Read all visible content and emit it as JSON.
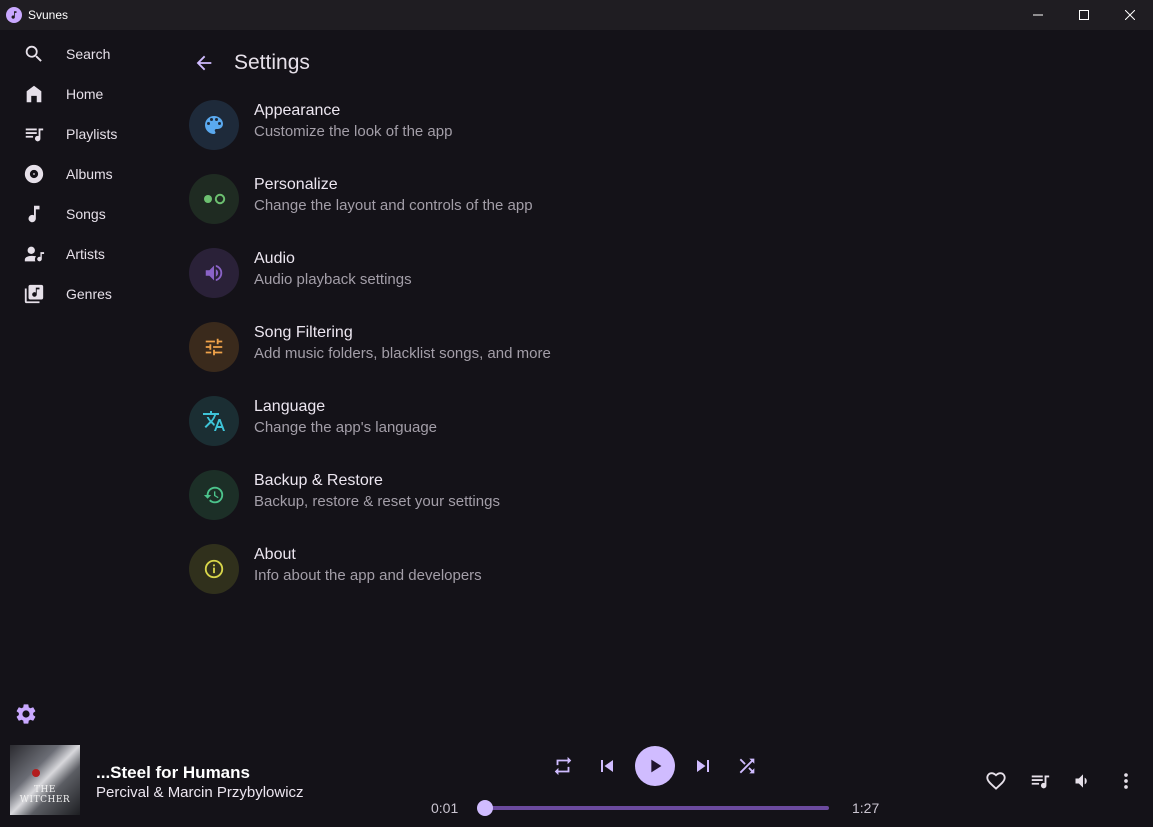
{
  "window": {
    "title": "Svunes",
    "controls": [
      "minimize-icon",
      "maximize-icon",
      "close-icon"
    ]
  },
  "sidebar": {
    "items": [
      {
        "label": "Search",
        "icon": "search-icon"
      },
      {
        "label": "Home",
        "icon": "home-icon"
      },
      {
        "label": "Playlists",
        "icon": "playlist-icon"
      },
      {
        "label": "Albums",
        "icon": "album-icon"
      },
      {
        "label": "Songs",
        "icon": "music-note-icon"
      },
      {
        "label": "Artists",
        "icon": "artist-icon"
      },
      {
        "label": "Genres",
        "icon": "genre-icon"
      }
    ],
    "settings_icon": "gear-icon"
  },
  "header": {
    "title": "Settings",
    "back_icon": "arrow-back-icon"
  },
  "settings": [
    {
      "title": "Appearance",
      "subtitle": "Customize the look of the app",
      "icon": "palette-icon",
      "bg": "#1e2a3a",
      "fg": "#5aa9ef"
    },
    {
      "title": "Personalize",
      "subtitle": "Change the layout and controls of the app",
      "icon": "toggle-icon",
      "bg": "#1f2b22",
      "fg": "#6cc070"
    },
    {
      "title": "Audio",
      "subtitle": "Audio playback settings",
      "icon": "volume-icon",
      "bg": "#2a2138",
      "fg": "#8a63c7"
    },
    {
      "title": "Song Filtering",
      "subtitle": "Add music folders, blacklist songs, and more",
      "icon": "tune-icon",
      "bg": "#3a2a1c",
      "fg": "#f0a34a"
    },
    {
      "title": "Language",
      "subtitle": "Change the app's language",
      "icon": "translate-icon",
      "bg": "#1b2e33",
      "fg": "#3ec4d8"
    },
    {
      "title": "Backup & Restore",
      "subtitle": "Backup, restore & reset your settings",
      "icon": "history-icon",
      "bg": "#1c2f27",
      "fg": "#4cc48c"
    },
    {
      "title": "About",
      "subtitle": "Info about the app and developers",
      "icon": "info-icon",
      "bg": "#30301c",
      "fg": "#d8d64a"
    }
  ],
  "player": {
    "album_brand": "THE WITCHER",
    "track_title": "...Steel for Humans",
    "artist": "Percival & Marcin Przybylowicz",
    "current_time": "0:01",
    "total_time": "1:27",
    "progress": 0.01,
    "controls": [
      "repeat-icon",
      "skip-previous-icon",
      "play-icon",
      "skip-next-icon",
      "shuffle-icon"
    ],
    "right_controls": [
      "heart-icon",
      "queue-icon",
      "volume-icon",
      "more-vert-icon"
    ],
    "accent": "#d0bcff"
  }
}
